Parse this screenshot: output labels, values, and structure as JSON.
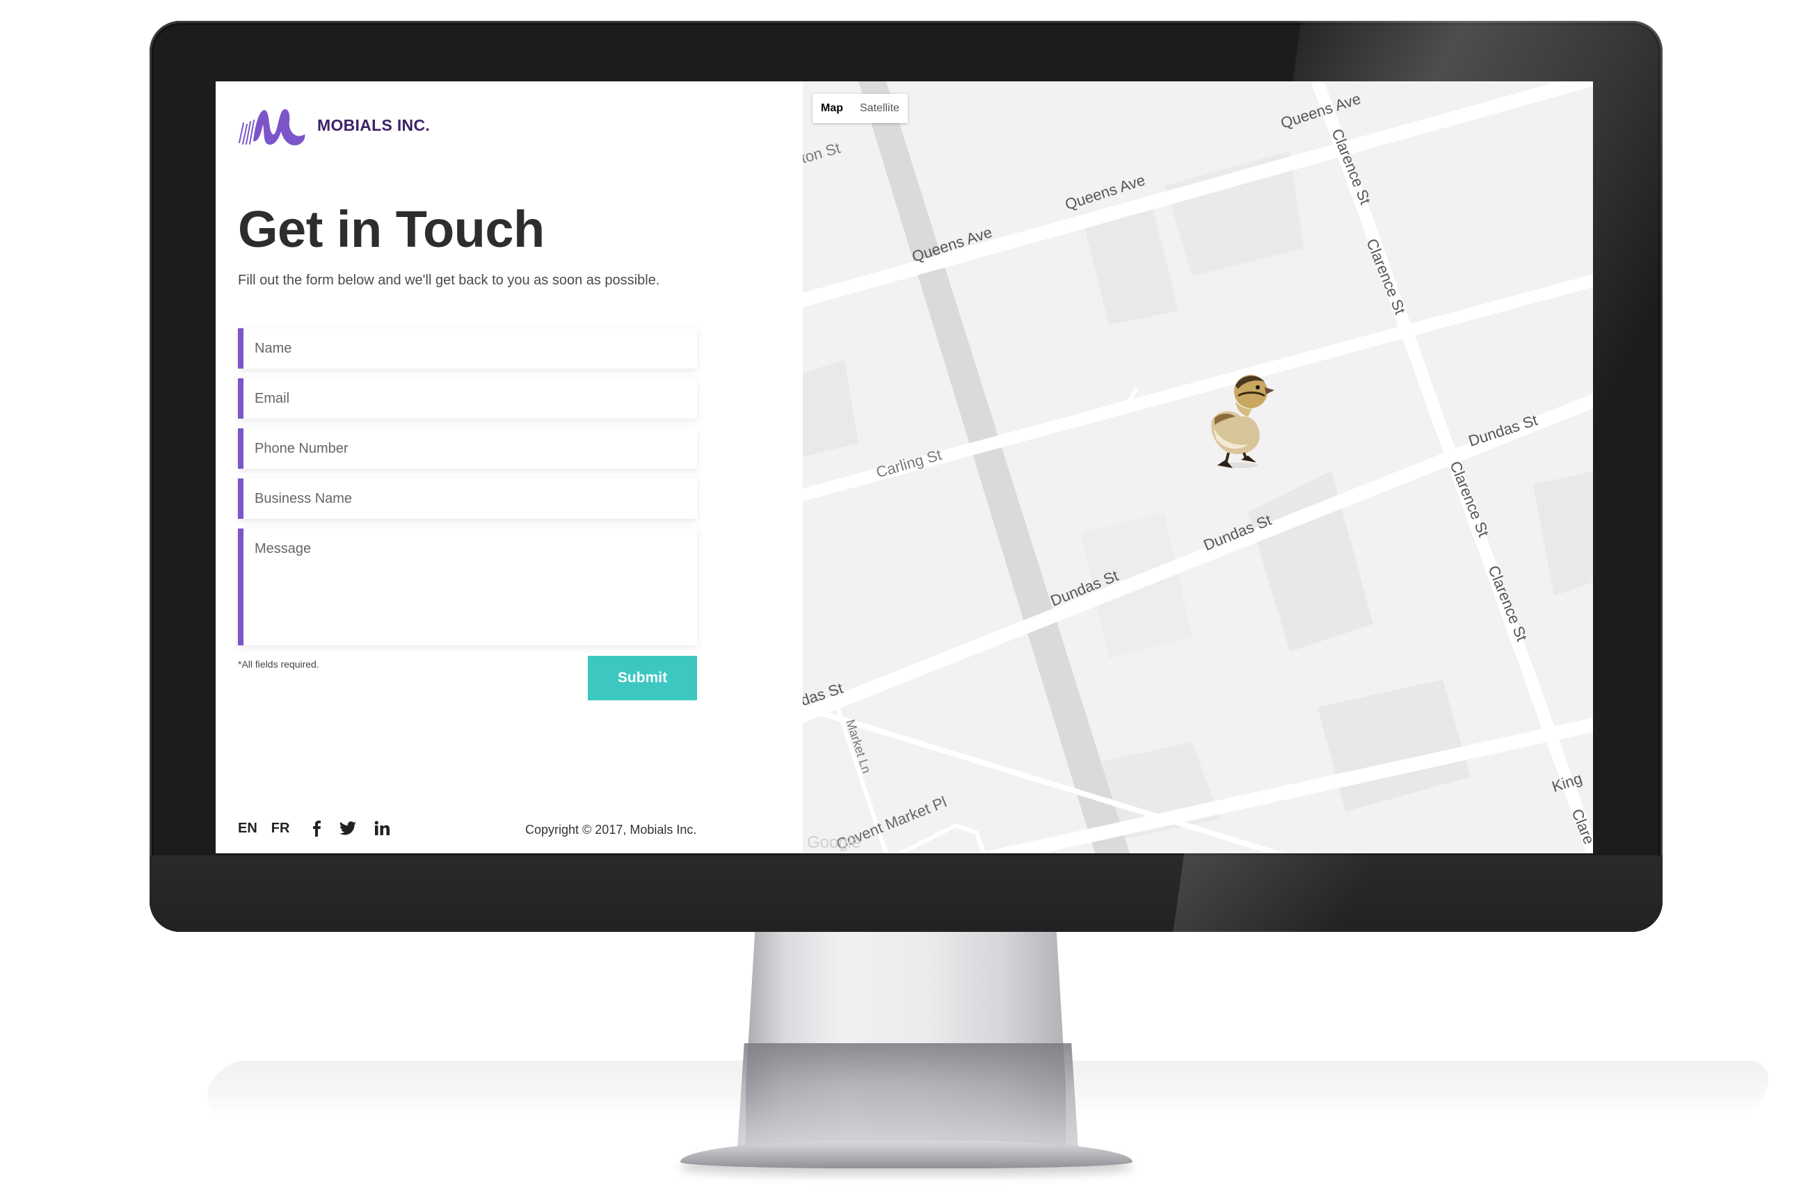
{
  "brand": {
    "name": "MOBIALS INC.",
    "accent": "#7b55c9",
    "logo_color": "#3b2269"
  },
  "contact": {
    "title": "Get in Touch",
    "subtitle": "Fill out the form below and we'll get back to you as soon as possible.",
    "fields": [
      {
        "placeholder": "Name"
      },
      {
        "placeholder": "Email"
      },
      {
        "placeholder": "Phone Number"
      },
      {
        "placeholder": "Business Name"
      },
      {
        "placeholder": "Message"
      }
    ],
    "required_note": "*All fields required.",
    "submit_label": "Submit",
    "submit_color": "#3cc7c1"
  },
  "footer": {
    "languages": [
      "EN",
      "FR"
    ],
    "social_icons": [
      "facebook-icon",
      "twitter-icon",
      "linkedin-icon"
    ],
    "copyright": "Copyright © 2017, Mobials Inc."
  },
  "map": {
    "type_options": [
      "Map",
      "Satellite"
    ],
    "selected_type": "Map",
    "street_labels": [
      "ton St",
      "Queens Ave",
      "Queens Ave",
      "Queens Ave",
      "Clarence St",
      "Clarence St",
      "Carling St",
      "Dundas St",
      "Dundas St",
      "Dundas St",
      "das St",
      "Clarence St",
      "Clarence St",
      "Market Ln",
      "Covent Market Pl",
      "King",
      "Clare"
    ],
    "attribution": "Google"
  }
}
